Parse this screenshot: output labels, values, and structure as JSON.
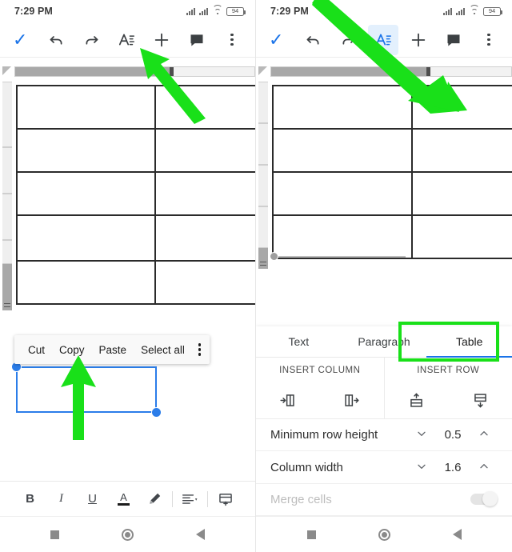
{
  "screens": [
    {
      "id": "left",
      "status": {
        "time": "7:29 PM",
        "battery": "94",
        "signal_icon": "signal-bars-icon",
        "wifi_icon": "wifi-icon",
        "battery_icon": "battery-icon"
      },
      "actionbar": {
        "accept_icon": "checkmark-icon",
        "items": [
          {
            "icon": "undo-icon",
            "active": false
          },
          {
            "icon": "redo-icon",
            "active": false
          },
          {
            "icon": "format-text-icon",
            "active": false
          },
          {
            "icon": "add-icon",
            "active": false
          },
          {
            "icon": "comment-icon",
            "active": false
          },
          {
            "icon": "overflow-menu-icon",
            "active": false
          }
        ]
      },
      "context_menu": {
        "items": [
          "Cut",
          "Copy",
          "Paste",
          "Select all"
        ],
        "overflow_icon": "overflow-menu-icon"
      },
      "format_toolbar": [
        {
          "icon": "bold-icon",
          "label": "B"
        },
        {
          "icon": "italic-icon",
          "label": "I"
        },
        {
          "icon": "underline-icon",
          "label": "U"
        },
        {
          "icon": "text-color-icon",
          "label": "A"
        },
        {
          "icon": "highlight-icon",
          "label": ""
        },
        {
          "icon": "align-icon",
          "label": ""
        },
        {
          "icon": "insert-table-icon",
          "label": ""
        }
      ]
    },
    {
      "id": "right",
      "status": {
        "time": "7:29 PM",
        "battery": "94",
        "signal_icon": "signal-bars-icon",
        "wifi_icon": "wifi-icon",
        "battery_icon": "battery-icon"
      },
      "actionbar": {
        "accept_icon": "checkmark-icon",
        "items": [
          {
            "icon": "undo-icon",
            "active": false
          },
          {
            "icon": "redo-icon",
            "active": false
          },
          {
            "icon": "format-text-icon",
            "active": true
          },
          {
            "icon": "add-icon",
            "active": false
          },
          {
            "icon": "comment-icon",
            "active": false
          },
          {
            "icon": "overflow-menu-icon",
            "active": false
          }
        ]
      },
      "format_panel": {
        "tabs": [
          {
            "label": "Text",
            "active": false
          },
          {
            "label": "Paragraph",
            "active": false
          },
          {
            "label": "Table",
            "active": true
          }
        ],
        "insert_column_header": "INSERT COLUMN",
        "insert_row_header": "INSERT ROW",
        "insert_column_icons": [
          "insert-column-left-icon",
          "insert-column-right-icon"
        ],
        "insert_row_icons": [
          "insert-row-above-icon",
          "insert-row-below-icon"
        ],
        "properties": [
          {
            "label": "Minimum row height",
            "value": "0.5",
            "decrease_icon": "chevron-down-icon",
            "increase_icon": "chevron-up-icon",
            "disabled": false
          },
          {
            "label": "Column width",
            "value": "1.6",
            "decrease_icon": "chevron-down-icon",
            "increase_icon": "chevron-up-icon",
            "disabled": false
          },
          {
            "label": "Merge cells",
            "value": "",
            "toggle_icon": "toggle-switch-off-icon",
            "disabled": true
          }
        ]
      }
    }
  ],
  "navbar": {
    "recents_icon": "recents-square-icon",
    "home_icon": "home-circle-icon",
    "back_icon": "back-triangle-icon"
  },
  "annotations": {
    "colors": {
      "arrow": "#19e019",
      "highlight_box": "#19e019",
      "accent": "#1a73e8"
    },
    "arrows": [
      {
        "name": "arrow-to-format-icon",
        "target": "format-text-icon"
      },
      {
        "name": "arrow-to-selected-cell",
        "target": "selected-table-cell"
      },
      {
        "name": "arrow-to-insert-row",
        "target": "insert-row-section"
      }
    ]
  }
}
